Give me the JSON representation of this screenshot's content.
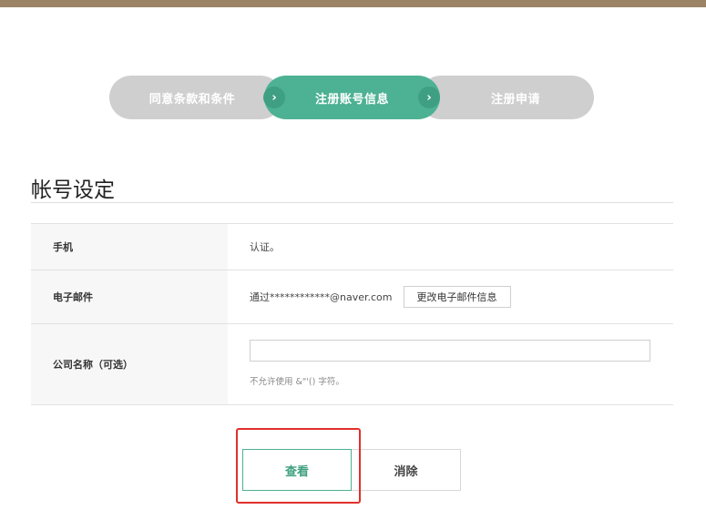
{
  "steps": {
    "step1": "同意条款和条件",
    "step2": "注册账号信息",
    "step3": "注册申请",
    "arrow": "›"
  },
  "section": {
    "title": "帐号设定"
  },
  "form": {
    "phone": {
      "label": "手机",
      "value": "认证。"
    },
    "email": {
      "label": "电子邮件",
      "value": "通过************@naver.com",
      "button": "更改电子邮件信息"
    },
    "company": {
      "label": "公司名称（可选）",
      "value": "",
      "placeholder": "",
      "hint": "不允许使用 &\"'() 字符。"
    }
  },
  "buttons": {
    "confirm": "查看",
    "cancel": "消除"
  },
  "colors": {
    "accent": "#4db193",
    "inactive": "#cfcfcf",
    "topbar": "#9b8366",
    "highlight": "#e0302b"
  }
}
